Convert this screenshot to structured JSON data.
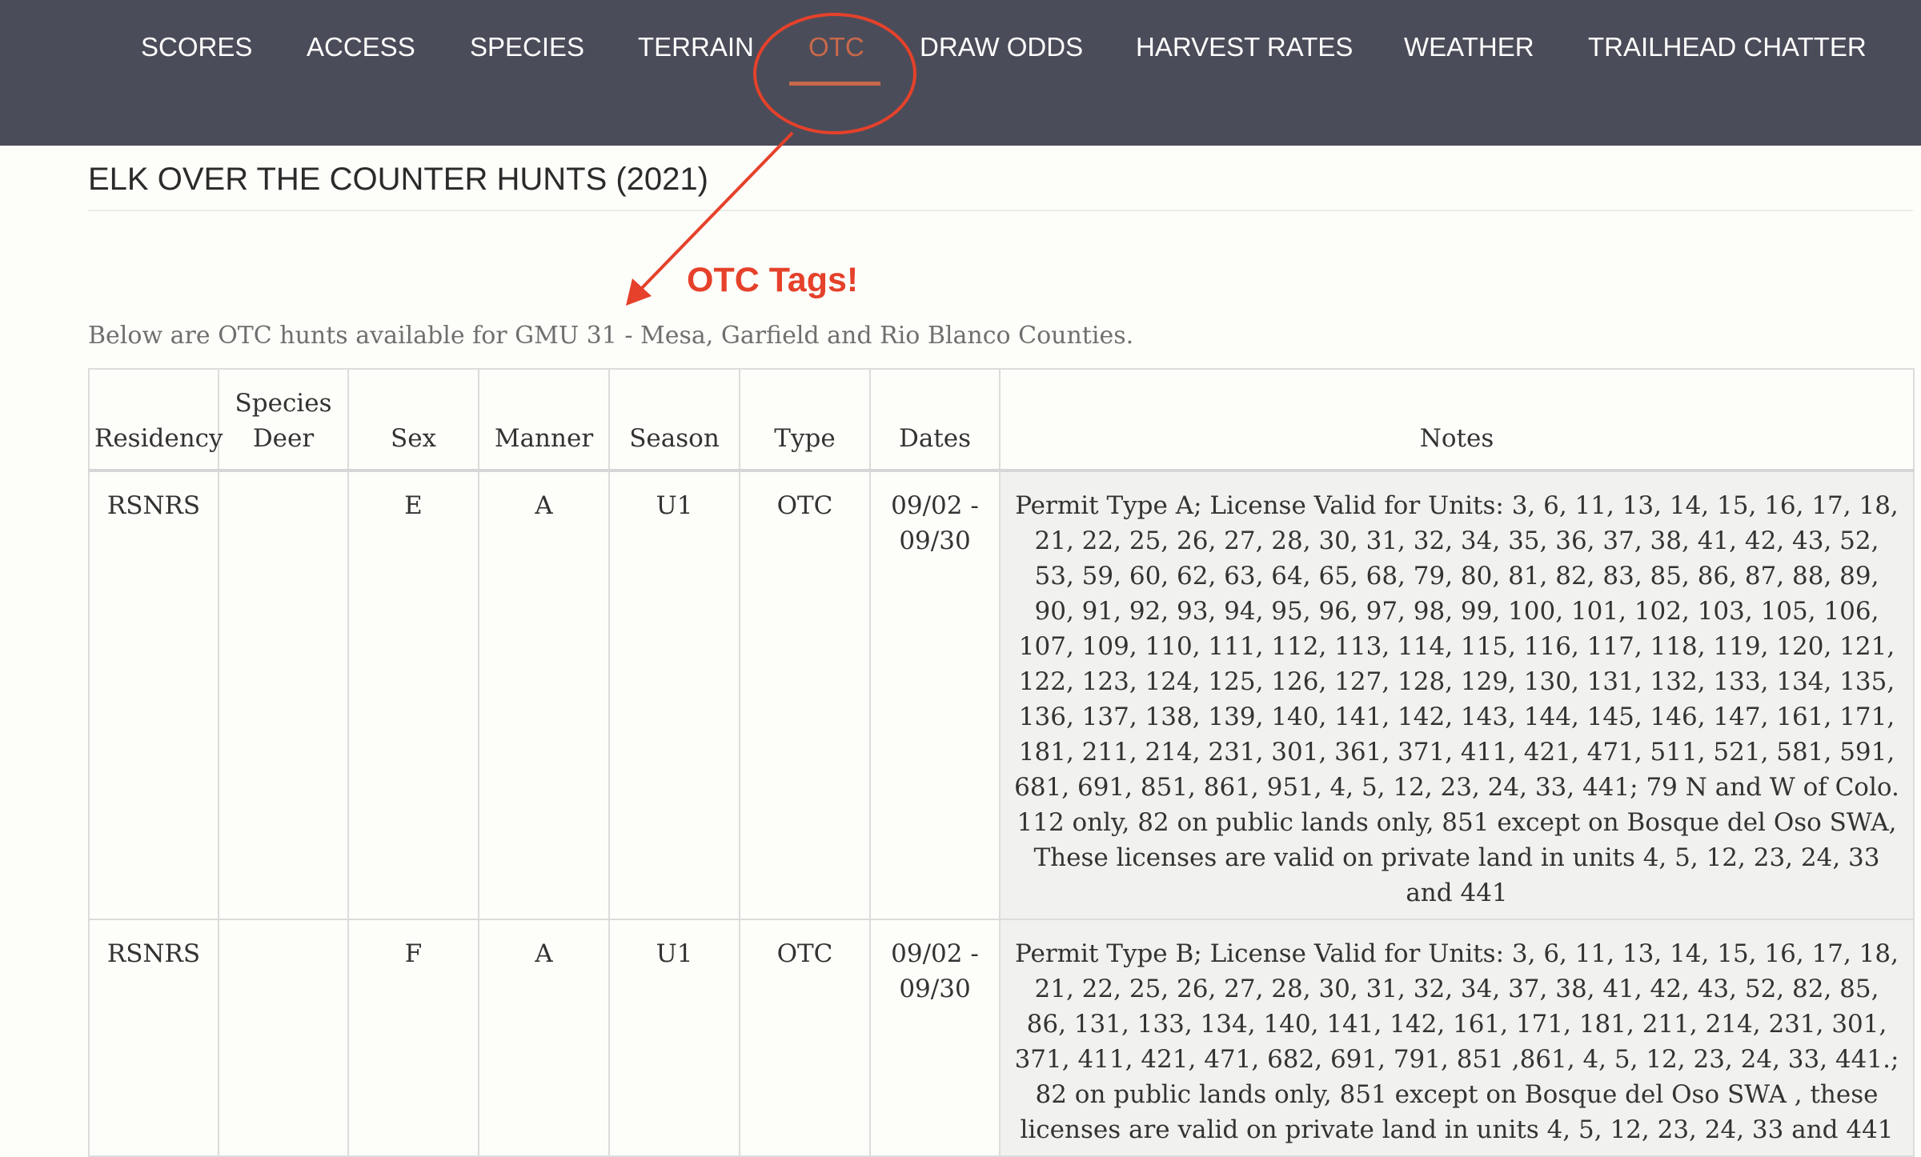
{
  "nav": {
    "items": [
      {
        "label": "SCORES"
      },
      {
        "label": "ACCESS"
      },
      {
        "label": "SPECIES"
      },
      {
        "label": "TERRAIN"
      },
      {
        "label": "OTC"
      },
      {
        "label": "DRAW ODDS"
      },
      {
        "label": "HARVEST RATES"
      },
      {
        "label": "WEATHER"
      },
      {
        "label": "TRAILHEAD CHATTER"
      }
    ],
    "active": "OTC",
    "background_color": "#4b4c59",
    "active_color": "#c8694a"
  },
  "page": {
    "title": "ELK OVER THE COUNTER HUNTS (2021)",
    "intro": "Below are OTC hunts available for GMU 31 - Mesa, Garfield and Rio Blanco Counties."
  },
  "annotation": {
    "label": "OTC Tags!",
    "color": "#e5412b"
  },
  "table": {
    "headers": {
      "residency": "Residency",
      "species_top": "Species",
      "species_bottom": "Deer",
      "sex": "Sex",
      "manner": "Manner",
      "season": "Season",
      "type": "Type",
      "dates": "Dates",
      "notes": "Notes"
    },
    "rows": [
      {
        "residency": "RSNRS",
        "species": "",
        "sex": "E",
        "manner": "A",
        "season": "U1",
        "type": "OTC",
        "dates_start": "09/02 -",
        "dates_end": "09/30",
        "notes": "Permit Type A; License Valid for Units: 3, 6, 11, 13, 14, 15, 16, 17, 18, 21, 22, 25, 26, 27, 28, 30, 31, 32, 34, 35, 36, 37, 38, 41, 42, 43, 52, 53, 59, 60, 62, 63, 64, 65, 68, 79, 80, 81, 82, 83, 85, 86, 87, 88, 89, 90, 91, 92, 93, 94, 95, 96, 97, 98, 99, 100, 101, 102, 103, 105, 106, 107, 109, 110, 111, 112, 113, 114, 115, 116, 117, 118, 119, 120, 121, 122, 123, 124, 125, 126, 127, 128, 129, 130, 131, 132, 133, 134, 135, 136, 137, 138, 139, 140, 141, 142, 143, 144, 145, 146, 147, 161, 171, 181, 211, 214, 231, 301, 361, 371, 411, 421, 471, 511, 521, 581, 591, 681, 691, 851, 861, 951, 4, 5, 12, 23, 24, 33, 441; 79 N and W of Colo. 112 only, 82 on public lands only, 851 except on Bosque del Oso SWA, These licenses are valid on private land in units 4, 5, 12, 23, 24, 33 and 441"
      },
      {
        "residency": "RSNRS",
        "species": "",
        "sex": "F",
        "manner": "A",
        "season": "U1",
        "type": "OTC",
        "dates_start": "09/02 -",
        "dates_end": "09/30",
        "notes": "Permit Type B; License Valid for Units: 3, 6, 11, 13, 14, 15, 16, 17, 18, 21, 22, 25, 26, 27, 28, 30, 31, 32, 34, 37, 38, 41, 42, 43, 52, 82, 85, 86, 131, 133, 134, 140, 141, 142, 161, 171, 181, 211, 214, 231, 301, 371, 411, 421, 471, 682, 691, 791, 851 ,861, 4, 5, 12, 23, 24, 33, 441.; 82 on public lands only, 851 except on Bosque del Oso SWA , these licenses are valid on private land in units 4, 5, 12, 23, 24, 33 and 441"
      }
    ]
  }
}
